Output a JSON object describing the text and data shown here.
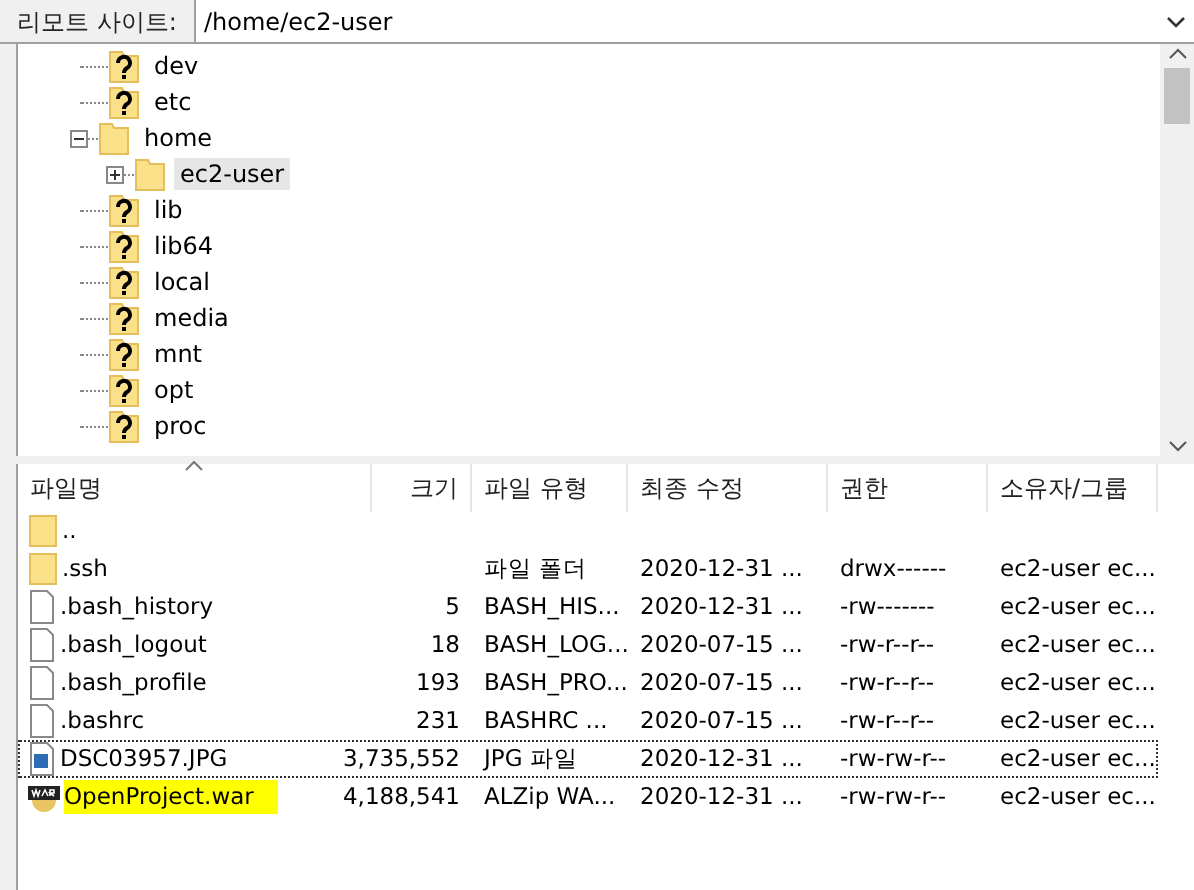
{
  "address": {
    "label": "리모트 사이트:",
    "value": "/home/ec2-user"
  },
  "tree": [
    {
      "name": "dev",
      "kind": "unknown"
    },
    {
      "name": "etc",
      "kind": "unknown"
    },
    {
      "name": "home",
      "kind": "folder",
      "expanded": true,
      "children": [
        {
          "name": "ec2-user",
          "kind": "folder",
          "expanded": false,
          "selected": true
        }
      ]
    },
    {
      "name": "lib",
      "kind": "unknown"
    },
    {
      "name": "lib64",
      "kind": "unknown"
    },
    {
      "name": "local",
      "kind": "unknown"
    },
    {
      "name": "media",
      "kind": "unknown"
    },
    {
      "name": "mnt",
      "kind": "unknown"
    },
    {
      "name": "opt",
      "kind": "unknown"
    },
    {
      "name": "proc",
      "kind": "unknown"
    }
  ],
  "table": {
    "columns": [
      {
        "label": "파일명",
        "sorted": true
      },
      {
        "label": "크기",
        "sorted": false
      },
      {
        "label": "파일 유형",
        "sorted": false
      },
      {
        "label": "최종 수정",
        "sorted": false
      },
      {
        "label": "권한",
        "sorted": false
      },
      {
        "label": "소유자/그룹",
        "sorted": false
      }
    ],
    "rows": [
      {
        "kind": "folder",
        "cells": [
          "..",
          "",
          "",
          "",
          "",
          ""
        ],
        "focused": false,
        "highlighted": false
      },
      {
        "kind": "folder",
        "cells": [
          ".ssh",
          "",
          "파일 폴더",
          "2020-12-31 ...",
          "drwx------",
          "ec2-user ec..."
        ],
        "focused": false,
        "highlighted": false
      },
      {
        "kind": "file",
        "cells": [
          ".bash_history",
          "5",
          "BASH_HIS...",
          "2020-12-31 ...",
          "-rw-------",
          "ec2-user ec..."
        ],
        "focused": false,
        "highlighted": false
      },
      {
        "kind": "file",
        "cells": [
          ".bash_logout",
          "18",
          "BASH_LOG...",
          "2020-07-15 ...",
          "-rw-r--r--",
          "ec2-user ec..."
        ],
        "focused": false,
        "highlighted": false
      },
      {
        "kind": "file",
        "cells": [
          ".bash_profile",
          "193",
          "BASH_PRO...",
          "2020-07-15 ...",
          "-rw-r--r--",
          "ec2-user ec..."
        ],
        "focused": false,
        "highlighted": false
      },
      {
        "kind": "file",
        "cells": [
          ".bashrc",
          "231",
          "BASHRC ...",
          "2020-07-15 ...",
          "-rw-r--r--",
          "ec2-user ec..."
        ],
        "focused": false,
        "highlighted": false
      },
      {
        "kind": "image",
        "cells": [
          "DSC03957.JPG",
          "3,735,552",
          "JPG 파일",
          "2020-12-31 ...",
          "-rw-rw-r--",
          "ec2-user ec..."
        ],
        "focused": true,
        "highlighted": false
      },
      {
        "kind": "archive",
        "cells": [
          "OpenProject.war",
          "4,188,541",
          "ALZip WA...",
          "2020-12-31 ...",
          "-rw-rw-r--",
          "ec2-user ec..."
        ],
        "focused": false,
        "highlighted": true
      }
    ]
  }
}
